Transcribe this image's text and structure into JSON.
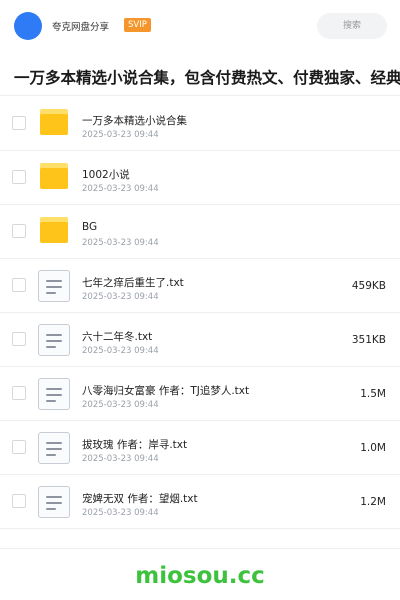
{
  "header": {
    "user_name": "夸克网盘分享",
    "badge": "SVIP",
    "search_placeholder": "搜索",
    "avatar_color": "#2f7bf5"
  },
  "page_title": "一万多本精选小说合集，包含付费热文、付费独家、经典等",
  "files": [
    {
      "type": "folder",
      "icon": "folder-icon",
      "name": "一万多本精选小说合集",
      "date": "2025-03-23 09:44",
      "size": ""
    },
    {
      "type": "folder",
      "icon": "folder-icon",
      "name": "1002小说",
      "date": "2025-03-23 09:44",
      "size": ""
    },
    {
      "type": "folder",
      "icon": "folder-icon",
      "name": "BG",
      "date": "2025-03-23 09:44",
      "size": ""
    },
    {
      "type": "file",
      "icon": "document-icon",
      "name": "七年之痒后重生了.txt",
      "date": "2025-03-23 09:44",
      "size": "459KB"
    },
    {
      "type": "file",
      "icon": "document-icon",
      "name": "六十二年冬.txt",
      "date": "2025-03-23 09:44",
      "size": "351KB"
    },
    {
      "type": "file",
      "icon": "document-icon",
      "name": "八零海归女富豪 作者：TJ追梦人.txt",
      "date": "2025-03-23 09:44",
      "size": "1.5M"
    },
    {
      "type": "file",
      "icon": "document-icon",
      "name": "拔玫瑰 作者：岸寻.txt",
      "date": "2025-03-23 09:44",
      "size": "1.0M"
    },
    {
      "type": "file",
      "icon": "document-icon",
      "name": "宠婢无双 作者：望烟.txt",
      "date": "2025-03-23 09:44",
      "size": "1.2M"
    }
  ],
  "footer": {
    "watermark": "miosou.cc"
  },
  "colors": {
    "badge": "#f5962c",
    "folder": "#ffc41a",
    "watermark": "#3cc23c"
  }
}
